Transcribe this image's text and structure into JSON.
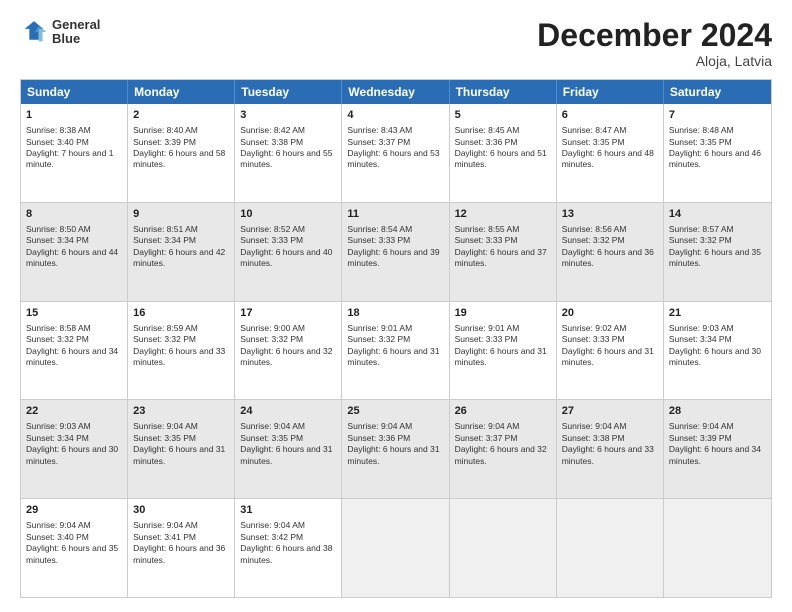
{
  "header": {
    "logo_line1": "General",
    "logo_line2": "Blue",
    "month": "December 2024",
    "location": "Aloja, Latvia"
  },
  "days_of_week": [
    "Sunday",
    "Monday",
    "Tuesday",
    "Wednesday",
    "Thursday",
    "Friday",
    "Saturday"
  ],
  "weeks": [
    [
      {
        "day": "1",
        "info": "Sunrise: 8:38 AM\nSunset: 3:40 PM\nDaylight: 7 hours and 1 minute.",
        "shaded": false
      },
      {
        "day": "2",
        "info": "Sunrise: 8:40 AM\nSunset: 3:39 PM\nDaylight: 6 hours and 58 minutes.",
        "shaded": false
      },
      {
        "day": "3",
        "info": "Sunrise: 8:42 AM\nSunset: 3:38 PM\nDaylight: 6 hours and 55 minutes.",
        "shaded": false
      },
      {
        "day": "4",
        "info": "Sunrise: 8:43 AM\nSunset: 3:37 PM\nDaylight: 6 hours and 53 minutes.",
        "shaded": false
      },
      {
        "day": "5",
        "info": "Sunrise: 8:45 AM\nSunset: 3:36 PM\nDaylight: 6 hours and 51 minutes.",
        "shaded": false
      },
      {
        "day": "6",
        "info": "Sunrise: 8:47 AM\nSunset: 3:35 PM\nDaylight: 6 hours and 48 minutes.",
        "shaded": false
      },
      {
        "day": "7",
        "info": "Sunrise: 8:48 AM\nSunset: 3:35 PM\nDaylight: 6 hours and 46 minutes.",
        "shaded": false
      }
    ],
    [
      {
        "day": "8",
        "info": "Sunrise: 8:50 AM\nSunset: 3:34 PM\nDaylight: 6 hours and 44 minutes.",
        "shaded": true
      },
      {
        "day": "9",
        "info": "Sunrise: 8:51 AM\nSunset: 3:34 PM\nDaylight: 6 hours and 42 minutes.",
        "shaded": true
      },
      {
        "day": "10",
        "info": "Sunrise: 8:52 AM\nSunset: 3:33 PM\nDaylight: 6 hours and 40 minutes.",
        "shaded": true
      },
      {
        "day": "11",
        "info": "Sunrise: 8:54 AM\nSunset: 3:33 PM\nDaylight: 6 hours and 39 minutes.",
        "shaded": true
      },
      {
        "day": "12",
        "info": "Sunrise: 8:55 AM\nSunset: 3:33 PM\nDaylight: 6 hours and 37 minutes.",
        "shaded": true
      },
      {
        "day": "13",
        "info": "Sunrise: 8:56 AM\nSunset: 3:32 PM\nDaylight: 6 hours and 36 minutes.",
        "shaded": true
      },
      {
        "day": "14",
        "info": "Sunrise: 8:57 AM\nSunset: 3:32 PM\nDaylight: 6 hours and 35 minutes.",
        "shaded": true
      }
    ],
    [
      {
        "day": "15",
        "info": "Sunrise: 8:58 AM\nSunset: 3:32 PM\nDaylight: 6 hours and 34 minutes.",
        "shaded": false
      },
      {
        "day": "16",
        "info": "Sunrise: 8:59 AM\nSunset: 3:32 PM\nDaylight: 6 hours and 33 minutes.",
        "shaded": false
      },
      {
        "day": "17",
        "info": "Sunrise: 9:00 AM\nSunset: 3:32 PM\nDaylight: 6 hours and 32 minutes.",
        "shaded": false
      },
      {
        "day": "18",
        "info": "Sunrise: 9:01 AM\nSunset: 3:32 PM\nDaylight: 6 hours and 31 minutes.",
        "shaded": false
      },
      {
        "day": "19",
        "info": "Sunrise: 9:01 AM\nSunset: 3:33 PM\nDaylight: 6 hours and 31 minutes.",
        "shaded": false
      },
      {
        "day": "20",
        "info": "Sunrise: 9:02 AM\nSunset: 3:33 PM\nDaylight: 6 hours and 31 minutes.",
        "shaded": false
      },
      {
        "day": "21",
        "info": "Sunrise: 9:03 AM\nSunset: 3:34 PM\nDaylight: 6 hours and 30 minutes.",
        "shaded": false
      }
    ],
    [
      {
        "day": "22",
        "info": "Sunrise: 9:03 AM\nSunset: 3:34 PM\nDaylight: 6 hours and 30 minutes.",
        "shaded": true
      },
      {
        "day": "23",
        "info": "Sunrise: 9:04 AM\nSunset: 3:35 PM\nDaylight: 6 hours and 31 minutes.",
        "shaded": true
      },
      {
        "day": "24",
        "info": "Sunrise: 9:04 AM\nSunset: 3:35 PM\nDaylight: 6 hours and 31 minutes.",
        "shaded": true
      },
      {
        "day": "25",
        "info": "Sunrise: 9:04 AM\nSunset: 3:36 PM\nDaylight: 6 hours and 31 minutes.",
        "shaded": true
      },
      {
        "day": "26",
        "info": "Sunrise: 9:04 AM\nSunset: 3:37 PM\nDaylight: 6 hours and 32 minutes.",
        "shaded": true
      },
      {
        "day": "27",
        "info": "Sunrise: 9:04 AM\nSunset: 3:38 PM\nDaylight: 6 hours and 33 minutes.",
        "shaded": true
      },
      {
        "day": "28",
        "info": "Sunrise: 9:04 AM\nSunset: 3:39 PM\nDaylight: 6 hours and 34 minutes.",
        "shaded": true
      }
    ],
    [
      {
        "day": "29",
        "info": "Sunrise: 9:04 AM\nSunset: 3:40 PM\nDaylight: 6 hours and 35 minutes.",
        "shaded": false
      },
      {
        "day": "30",
        "info": "Sunrise: 9:04 AM\nSunset: 3:41 PM\nDaylight: 6 hours and 36 minutes.",
        "shaded": false
      },
      {
        "day": "31",
        "info": "Sunrise: 9:04 AM\nSunset: 3:42 PM\nDaylight: 6 hours and 38 minutes.",
        "shaded": false
      },
      {
        "day": "",
        "info": "",
        "shaded": false,
        "empty": true
      },
      {
        "day": "",
        "info": "",
        "shaded": false,
        "empty": true
      },
      {
        "day": "",
        "info": "",
        "shaded": false,
        "empty": true
      },
      {
        "day": "",
        "info": "",
        "shaded": false,
        "empty": true
      }
    ]
  ]
}
